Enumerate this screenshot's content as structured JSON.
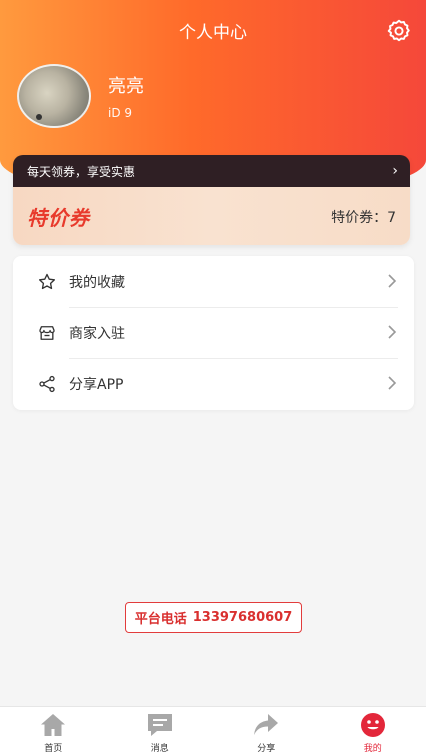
{
  "header": {
    "title": "个人中心",
    "settings_icon": "gear-icon"
  },
  "profile": {
    "username": "亮亮",
    "user_id": "iD 9"
  },
  "coupon": {
    "banner_text": "每天领券，享受实惠",
    "banner_arrow": "›",
    "logo_text": "特价券",
    "count_label": "特价券：7"
  },
  "menu": {
    "items": [
      {
        "label": "我的收藏",
        "icon": "star-icon"
      },
      {
        "label": "商家入驻",
        "icon": "store-icon"
      },
      {
        "label": "分享APP",
        "icon": "share-icon"
      }
    ]
  },
  "contact": {
    "phone_label": "平台电话",
    "phone_number": "13397680607"
  },
  "tabbar": {
    "tabs": [
      {
        "label": "首页",
        "icon": "home-icon"
      },
      {
        "label": "消息",
        "icon": "message-icon"
      },
      {
        "label": "分享",
        "icon": "share-arrow-icon"
      },
      {
        "label": "我的",
        "icon": "smile-icon"
      }
    ],
    "active_index": 3
  },
  "colors": {
    "header_start": "#ff9a3e",
    "header_end": "#f5483a",
    "accent_red": "#e3273a",
    "coupon_dark": "#2f1f24",
    "coupon_light": "#f7d8c2"
  }
}
